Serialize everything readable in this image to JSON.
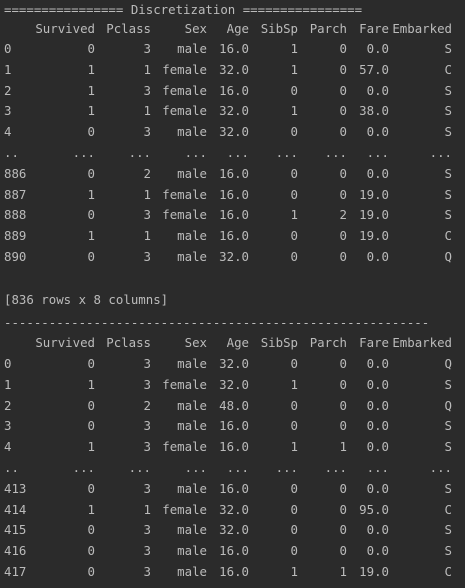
{
  "title_line": "================ Discretization ================",
  "columns": [
    "",
    "Survived",
    "Pclass",
    "Sex",
    "Age",
    "SibSp",
    "Parch",
    "Fare",
    "Embarked"
  ],
  "table1": {
    "rows": [
      [
        "0",
        "0",
        "3",
        "male",
        "16.0",
        "1",
        "0",
        "0.0",
        "S"
      ],
      [
        "1",
        "1",
        "1",
        "female",
        "32.0",
        "1",
        "0",
        "57.0",
        "C"
      ],
      [
        "2",
        "1",
        "3",
        "female",
        "16.0",
        "0",
        "0",
        "0.0",
        "S"
      ],
      [
        "3",
        "1",
        "1",
        "female",
        "32.0",
        "1",
        "0",
        "38.0",
        "S"
      ],
      [
        "4",
        "0",
        "3",
        "male",
        "32.0",
        "0",
        "0",
        "0.0",
        "S"
      ],
      [
        "..",
        "...",
        "...",
        "...",
        "...",
        "...",
        "...",
        "...",
        "..."
      ],
      [
        "886",
        "0",
        "2",
        "male",
        "16.0",
        "0",
        "0",
        "0.0",
        "S"
      ],
      [
        "887",
        "1",
        "1",
        "female",
        "16.0",
        "0",
        "0",
        "19.0",
        "S"
      ],
      [
        "888",
        "0",
        "3",
        "female",
        "16.0",
        "1",
        "2",
        "19.0",
        "S"
      ],
      [
        "889",
        "1",
        "1",
        "male",
        "16.0",
        "0",
        "0",
        "19.0",
        "C"
      ],
      [
        "890",
        "0",
        "3",
        "male",
        "32.0",
        "0",
        "0",
        "0.0",
        "Q"
      ]
    ]
  },
  "summary_line": "[836 rows x 8 columns]",
  "divider_line": "---------------------------------------------------------",
  "table2": {
    "rows": [
      [
        "0",
        "0",
        "3",
        "male",
        "32.0",
        "0",
        "0",
        "0.0",
        "Q"
      ],
      [
        "1",
        "1",
        "3",
        "female",
        "32.0",
        "1",
        "0",
        "0.0",
        "S"
      ],
      [
        "2",
        "0",
        "2",
        "male",
        "48.0",
        "0",
        "0",
        "0.0",
        "Q"
      ],
      [
        "3",
        "0",
        "3",
        "male",
        "16.0",
        "0",
        "0",
        "0.0",
        "S"
      ],
      [
        "4",
        "1",
        "3",
        "female",
        "16.0",
        "1",
        "1",
        "0.0",
        "S"
      ],
      [
        "..",
        "...",
        "...",
        "...",
        "...",
        "...",
        "...",
        "...",
        "..."
      ],
      [
        "413",
        "0",
        "3",
        "male",
        "16.0",
        "0",
        "0",
        "0.0",
        "S"
      ],
      [
        "414",
        "1",
        "1",
        "female",
        "32.0",
        "0",
        "0",
        "95.0",
        "C"
      ],
      [
        "415",
        "0",
        "3",
        "male",
        "32.0",
        "0",
        "0",
        "0.0",
        "S"
      ],
      [
        "416",
        "0",
        "3",
        "male",
        "16.0",
        "0",
        "0",
        "0.0",
        "S"
      ],
      [
        "417",
        "0",
        "3",
        "male",
        "16.0",
        "1",
        "1",
        "19.0",
        "C"
      ]
    ]
  }
}
